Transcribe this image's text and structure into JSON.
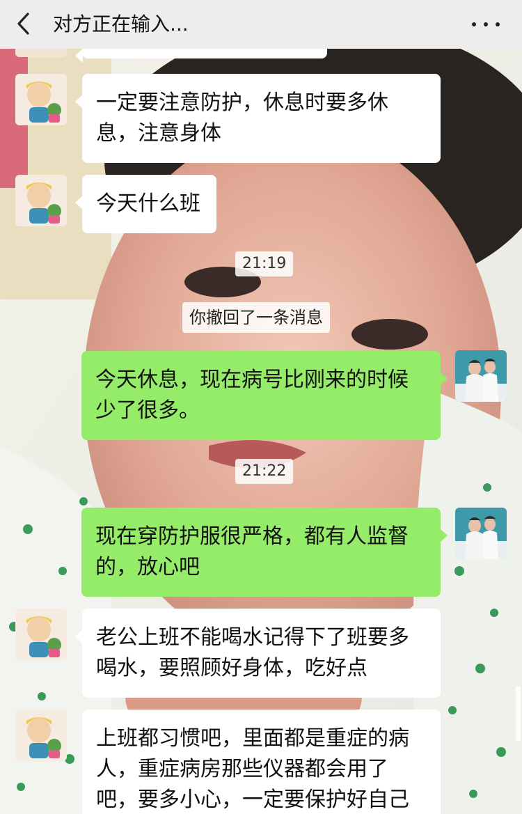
{
  "header": {
    "title": "对方正在输入...",
    "back_icon": "chevron-left-icon",
    "more_icon": "more-dots-icon"
  },
  "messages": [
    {
      "side": "in",
      "text": "一定要注意防护，休息时要多休息，注意身体"
    },
    {
      "side": "in",
      "text": "今天什么班"
    },
    {
      "time": "21:19"
    },
    {
      "system": "你撤回了一条消息"
    },
    {
      "side": "out",
      "text": "今天休息，现在病号比刚来的时候少了很多。"
    },
    {
      "time": "21:22"
    },
    {
      "side": "out",
      "text": "现在穿防护服很严格，都有人监督的，放心吧"
    },
    {
      "side": "in",
      "text": "老公上班不能喝水记得下了班要多喝水，要照顾好身体，吃好点"
    },
    {
      "side": "in",
      "text": "上班都习惯吧，里面都是重症的病人，重症病房那些仪器都会用了吧，要多小心，一定要保护好自己"
    }
  ],
  "colors": {
    "header_bg": "#ededed",
    "incoming_bubble": "#ffffff",
    "outgoing_bubble": "#95ec69"
  }
}
